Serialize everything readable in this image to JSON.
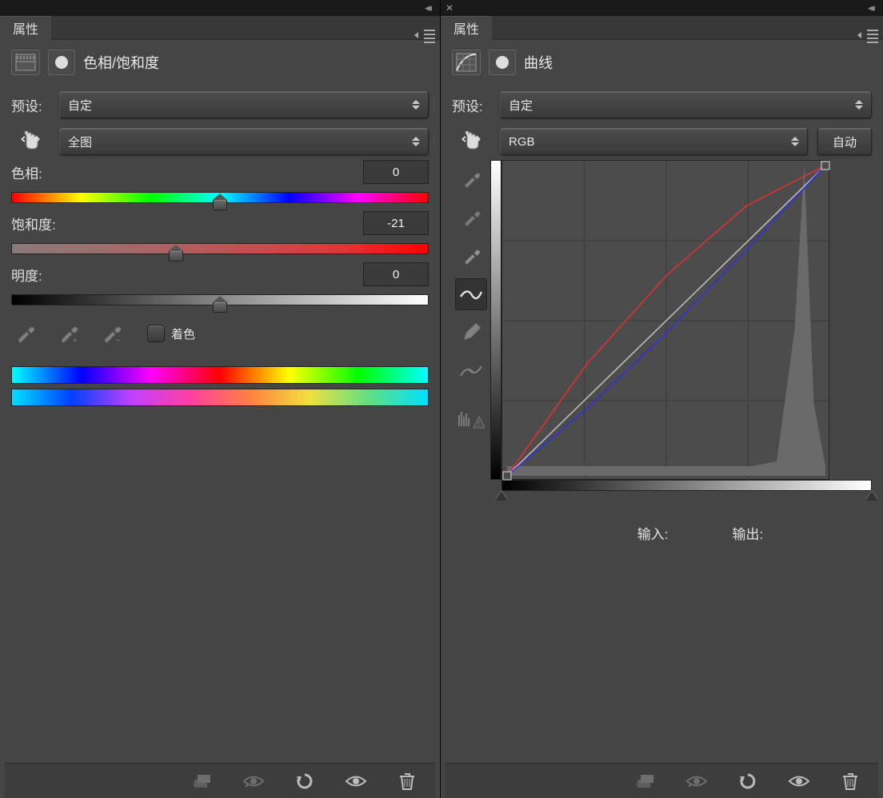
{
  "left": {
    "tab": "属性",
    "title": "色相/饱和度",
    "preset_label": "预设:",
    "preset_value": "自定",
    "range_value": "全图",
    "hue_label": "色相:",
    "hue_value": "0",
    "sat_label": "饱和度:",
    "sat_value": "-21",
    "light_label": "明度:",
    "light_value": "0",
    "colorize_label": "着色"
  },
  "right": {
    "tab": "属性",
    "title": "曲线",
    "preset_label": "预设:",
    "preset_value": "自定",
    "channel_value": "RGB",
    "auto_label": "自动",
    "input_label": "输入:",
    "output_label": "输出:"
  },
  "chart_data": {
    "type": "line",
    "title": "曲线",
    "xlim": [
      0,
      255
    ],
    "ylim": [
      0,
      255
    ],
    "series": [
      {
        "name": "baseline",
        "color": "#bbbbbb",
        "x": [
          0,
          255
        ],
        "y": [
          0,
          255
        ]
      },
      {
        "name": "red",
        "color": "#e03030",
        "x": [
          0,
          64,
          128,
          192,
          255
        ],
        "y": [
          0,
          92,
          165,
          222,
          255
        ]
      },
      {
        "name": "blue",
        "color": "#3030e0",
        "x": [
          0,
          64,
          128,
          192,
          255
        ],
        "y": [
          0,
          55,
          118,
          186,
          255
        ]
      }
    ],
    "histogram": {
      "peak_x": 238,
      "peak_height": 255,
      "shoulder_x": 216,
      "floor_height": 12
    }
  }
}
